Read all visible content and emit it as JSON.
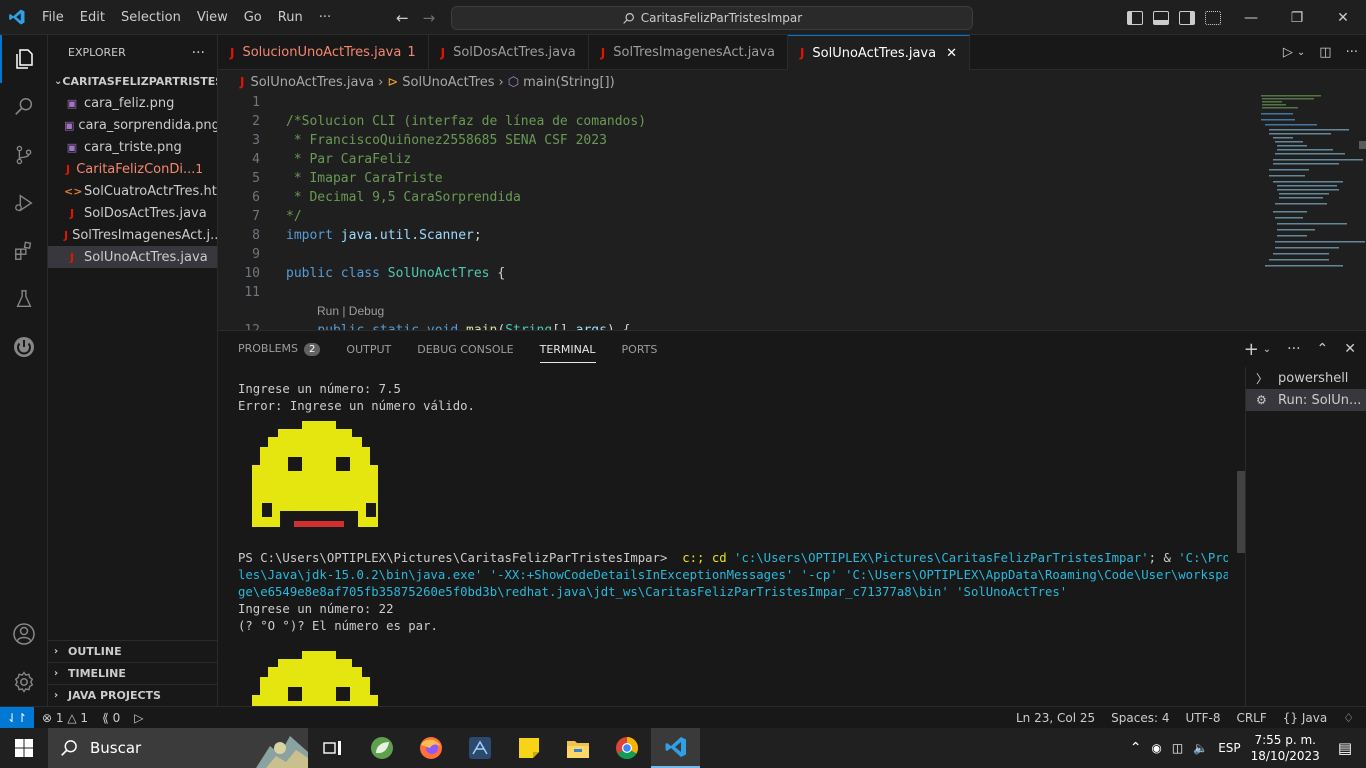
{
  "titlebar": {
    "menu": [
      "File",
      "Edit",
      "Selection",
      "View",
      "Go",
      "Run",
      "···"
    ],
    "search_text": "CaritasFelizParTristesImpar"
  },
  "sidebar": {
    "title": "EXPLORER",
    "folder": "CARITASFELIZPARTRISTESI...",
    "files": [
      {
        "name": "cara_feliz.png",
        "icon": "image-file-icon",
        "kind": "img"
      },
      {
        "name": "cara_sorprendida.png",
        "icon": "image-file-icon",
        "kind": "img"
      },
      {
        "name": "cara_triste.png",
        "icon": "image-file-icon",
        "kind": "img"
      },
      {
        "name": "CaritaFelizConDi...",
        "icon": "java-file-icon",
        "kind": "java",
        "error": true,
        "count": "1"
      },
      {
        "name": "SolCuatroActrTres.html",
        "icon": "html-file-icon",
        "kind": "html"
      },
      {
        "name": "SolDosActTres.java",
        "icon": "java-file-icon",
        "kind": "java"
      },
      {
        "name": "SolTresImagenesAct.j...",
        "icon": "java-file-icon",
        "kind": "java"
      },
      {
        "name": "SolUnoActTres.java",
        "icon": "java-file-icon",
        "kind": "java",
        "selected": true
      }
    ],
    "outline": "OUTLINE",
    "timeline": "TIMELINE",
    "java_projects": "JAVA PROJECTS"
  },
  "tabs": [
    {
      "label": "SolucionUnoActTres.java",
      "badge": "1",
      "error": true
    },
    {
      "label": "SolDosActTres.java"
    },
    {
      "label": "SolTresImagenesAct.java"
    },
    {
      "label": "SolUnoActTres.java",
      "active": true
    }
  ],
  "breadcrumb": {
    "file": "SolUnoActTres.java",
    "class": "SolUnoActTres",
    "method": "main(String[])"
  },
  "editor": {
    "line_numbers": [
      "1",
      "2",
      "3",
      "4",
      "5",
      "6",
      "7",
      "8",
      "9",
      "10",
      "11",
      "12"
    ],
    "lines": [
      "",
      "/*Solucion CLI (interfaz de línea de comandos)",
      " * FranciscoQuiñonez2558685 SENA CSF 2023",
      " * Par CaraFeliz",
      " * Imapar CaraTriste",
      " * Decimal 9,5 CaraSorprendida",
      "*/",
      "import java.util.Scanner;",
      "",
      "public class SolUnoActTres {",
      "",
      "    public static void main(String[] args) {"
    ],
    "import_kw": "import",
    "import_pkg": "java.util.Scanner",
    "public_kw": "public",
    "class_kw": "class",
    "class_name": "SolUnoActTres",
    "static_kw": "static",
    "void_kw": "void",
    "main_fn": "main",
    "string_type": "String",
    "args_var": "args",
    "codelens": "Run | Debug"
  },
  "panel": {
    "tabs": [
      "PROBLEMS",
      "OUTPUT",
      "DEBUG CONSOLE",
      "TERMINAL",
      "PORTS"
    ],
    "problems_count": "2",
    "active_tab": "TERMINAL",
    "terminal": {
      "line1": "Ingrese un número: 7.5",
      "line2": "Error: Ingrese un número válido.",
      "prompt": "PS C:\\Users\\OPTIPLEX\\Pictures\\CaritasFelizParTristesImpar>",
      "cmd1": "c:; cd",
      "path1": "'c:\\Users\\OPTIPLEX\\Pictures\\CaritasFelizParTristesImpar'",
      "amp": "; &",
      "java_path_a": "'C:\\Program Fi",
      "java_path_b": "les\\Java\\jdk-15.0.2\\bin\\java.exe'",
      "flag": "'-XX:+ShowCodeDetailsInExceptionMessages'",
      "cp_flag": "'-cp'",
      "cp_path_a": "'C:\\Users\\OPTIPLEX\\AppData\\Roaming\\Code\\User\\workspaceStora",
      "cp_path_b": "ge\\e6549e8e8af705fb35875260e5f0bd3b\\redhat.java\\jdt_ws\\CaritasFelizParTristesImpar_c71377a8\\bin'",
      "main_class": "'SolUnoActTres'",
      "line3": "Ingrese un número: 22",
      "line4": "(? °O °)? El número es par."
    },
    "terminal_list": [
      {
        "label": "powershell",
        "icon": "terminal-icon"
      },
      {
        "label": "Run: SolUn...",
        "icon": "debug-gear-icon",
        "selected": true
      }
    ]
  },
  "statusbar": {
    "errors": "1",
    "warnings": "1",
    "ports": "0",
    "position": "Ln 23, Col 25",
    "spaces": "Spaces: 4",
    "encoding": "UTF-8",
    "eol": "CRLF",
    "language": "Java"
  },
  "taskbar": {
    "search": "Buscar",
    "lang": "ESP",
    "time": "7:55 p. m.",
    "date": "18/10/2023"
  },
  "colors": {
    "accent": "#0078d4",
    "smiley": "#e5e510",
    "error": "#f48771",
    "java": "#e51400"
  }
}
